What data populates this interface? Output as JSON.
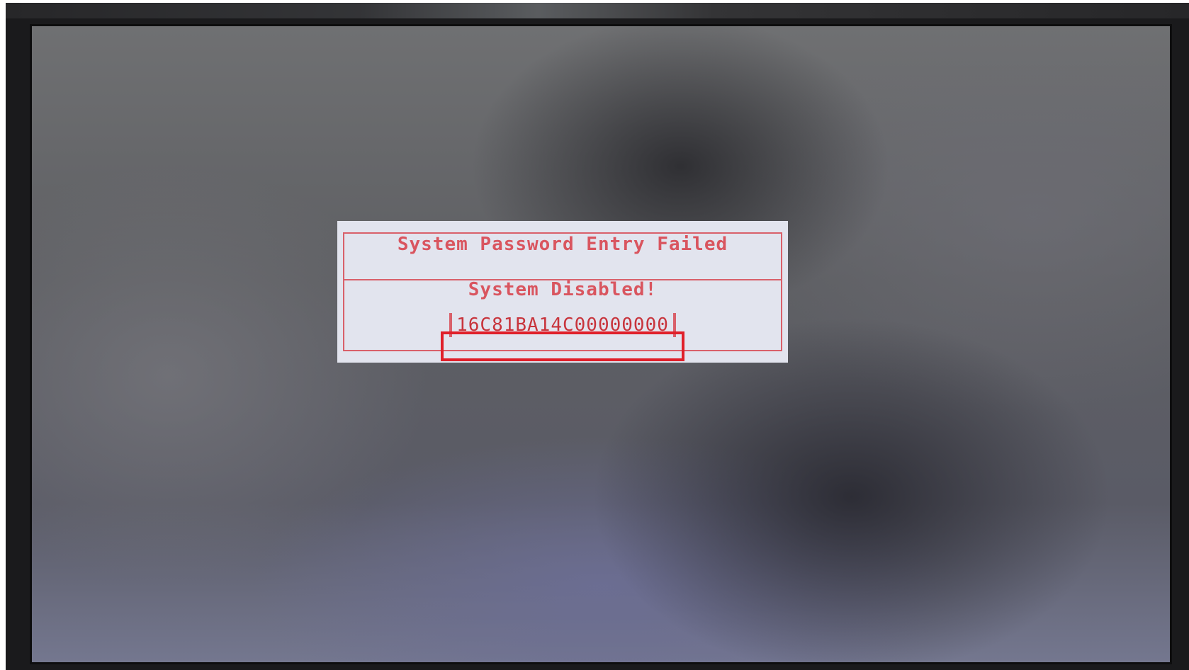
{
  "dialog": {
    "title": "System Password Entry Failed",
    "message": "System Disabled!",
    "code": "16C81BA14C00000000"
  },
  "colors": {
    "dialog_background": "#e2e4ee",
    "dialog_text": "#d9555f",
    "highlight_box": "#e0202a"
  }
}
